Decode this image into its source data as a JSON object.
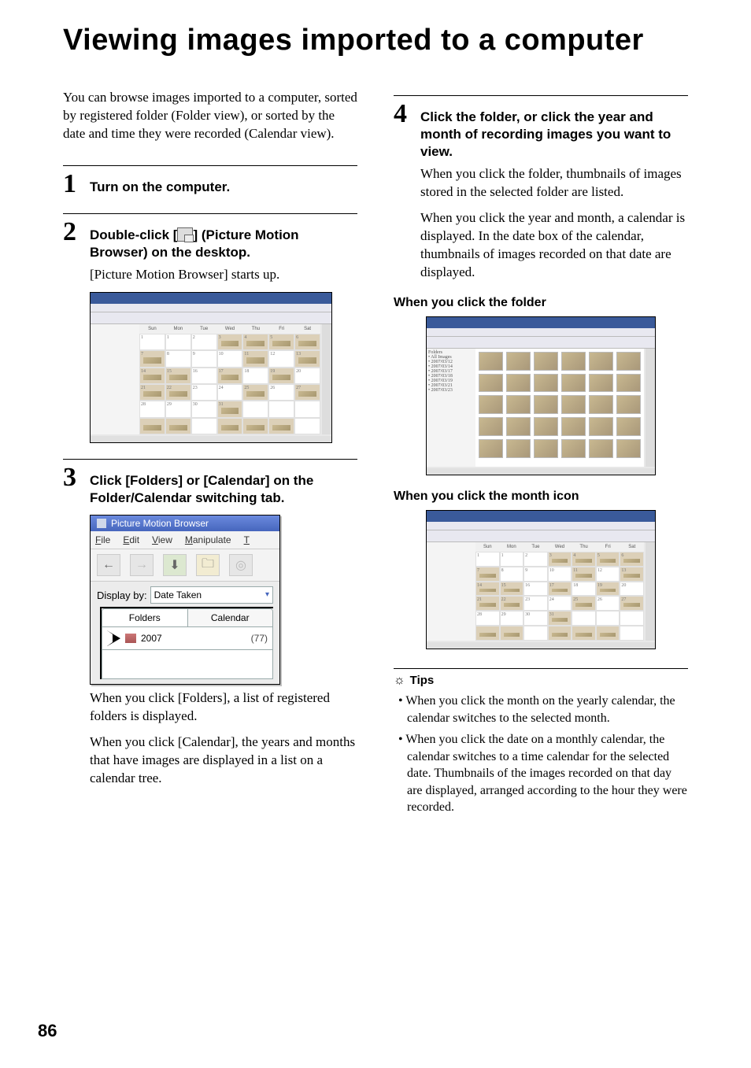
{
  "page": {
    "title": "Viewing images imported to a computer",
    "number": "86",
    "intro": "You can browse images imported to a computer, sorted by registered folder (Folder view), or sorted by the date and time they were recorded (Calendar view)."
  },
  "steps": {
    "s1": {
      "num": "1",
      "title": "Turn on the computer."
    },
    "s2": {
      "num": "2",
      "title_pre": "Double-click [",
      "title_post": "] (Picture Motion Browser) on the desktop.",
      "body": "[Picture Motion Browser] starts up."
    },
    "s3": {
      "num": "3",
      "title": "Click [Folders] or [Calendar] on the Folder/Calendar switching tab.",
      "body1": "When you click [Folders], a list of registered folders is displayed.",
      "body2": "When you click [Calendar], the years and months that have images are displayed in a list on a calendar tree."
    },
    "s4": {
      "num": "4",
      "title": "Click the folder, or click the year and month of recording images you want to view.",
      "body1": "When you click the folder, thumbnails of images stored in the selected folder are listed.",
      "body2": "When you click the year and month, a calendar is displayed. In the date box of the calendar, thumbnails of images recorded on that date are displayed."
    }
  },
  "cal_days": [
    "Sun",
    "Mon",
    "Tue",
    "Wed",
    "Thu",
    "Fri",
    "Sat"
  ],
  "pmb": {
    "window_title": "Picture Motion Browser",
    "menu": {
      "file": "File",
      "edit": "Edit",
      "view": "View",
      "manipulate": "Manipulate",
      "tools": "T"
    },
    "display_by_label": "Display by:",
    "display_by_value": "Date Taken",
    "tab_folders": "Folders",
    "tab_calendar": "Calendar",
    "year": "2007",
    "count": "(77)"
  },
  "sub": {
    "folder": "When you click the folder",
    "month": "When you click the month icon",
    "tips_head": "Tips"
  },
  "tips": {
    "t1": "When you click the month on the yearly calendar, the calendar switches to the selected month.",
    "t2": "When you click the date on a monthly calendar, the calendar switches to a time calendar for the selected date. Thumbnails of the images recorded on that day are displayed, arranged according to the hour they were recorded."
  }
}
